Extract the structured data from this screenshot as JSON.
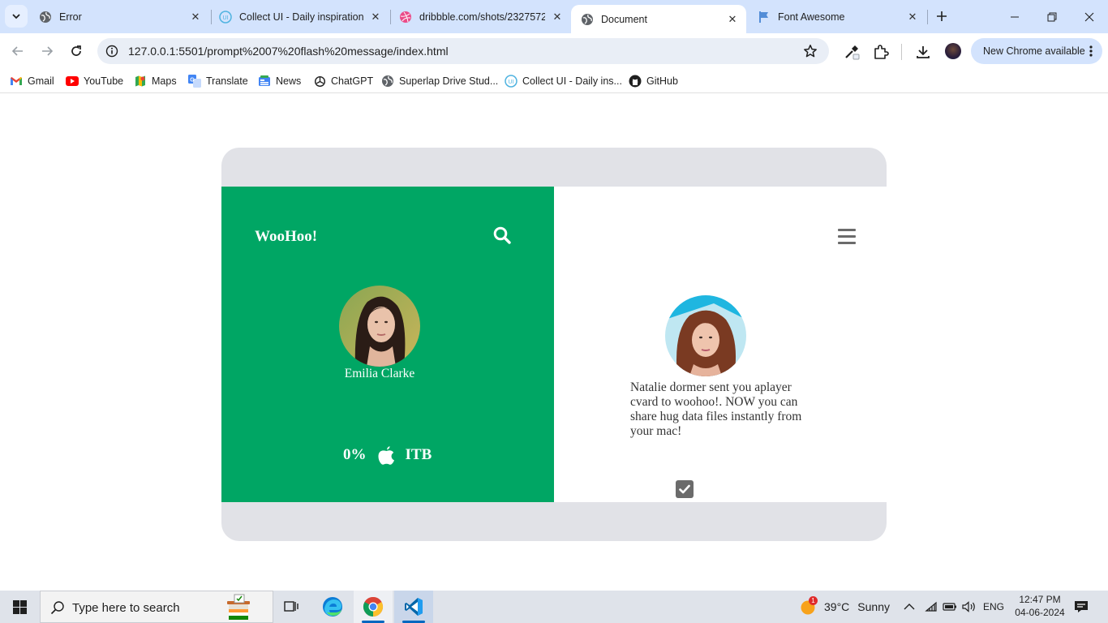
{
  "browser": {
    "tabs": [
      {
        "title": "Error",
        "favicon": "globe-icon"
      },
      {
        "title": "Collect UI - Daily inspiration",
        "favicon": "collectui-icon"
      },
      {
        "title": "dribbble.com/shots/2327572",
        "favicon": "dribbble-icon"
      },
      {
        "title": "Document",
        "favicon": "globe-icon",
        "active": true
      },
      {
        "title": "Font Awesome",
        "favicon": "flag-icon"
      }
    ],
    "url": "127.0.0.1:5501/prompt%2007%20flash%20message/index.html",
    "update_pill": "New Chrome available",
    "bookmarks": [
      {
        "label": "Gmail",
        "icon": "gmail-icon"
      },
      {
        "label": "YouTube",
        "icon": "youtube-icon"
      },
      {
        "label": "Maps",
        "icon": "maps-icon"
      },
      {
        "label": "Translate",
        "icon": "translate-icon"
      },
      {
        "label": "News",
        "icon": "news-icon"
      },
      {
        "label": "ChatGPT",
        "icon": "chatgpt-icon"
      },
      {
        "label": "Superlap Drive Stud...",
        "icon": "globe-icon"
      },
      {
        "label": "Collect UI - Daily ins...",
        "icon": "collectui-icon"
      },
      {
        "label": "GitHub",
        "icon": "github-icon"
      }
    ]
  },
  "app": {
    "brand": "WooHoo!",
    "left": {
      "person_name": "Emilia Clarke",
      "percent": "0%",
      "size": "ITB"
    },
    "right": {
      "message": "Natalie dormer sent you aplayer cvard to woohoo!. NOW you can share hug data files instantly from your mac!",
      "checked": true
    },
    "colors": {
      "accent_green": "#00a664",
      "card_gray": "#e1e2e7",
      "icon_gray": "#6b6b6b"
    }
  },
  "taskbar": {
    "search_placeholder": "Type here to search",
    "weather_temp": "39°C",
    "weather_desc": "Sunny",
    "weather_badge": "1",
    "language": "ENG",
    "time": "12:47 PM",
    "date": "04-06-2024"
  }
}
